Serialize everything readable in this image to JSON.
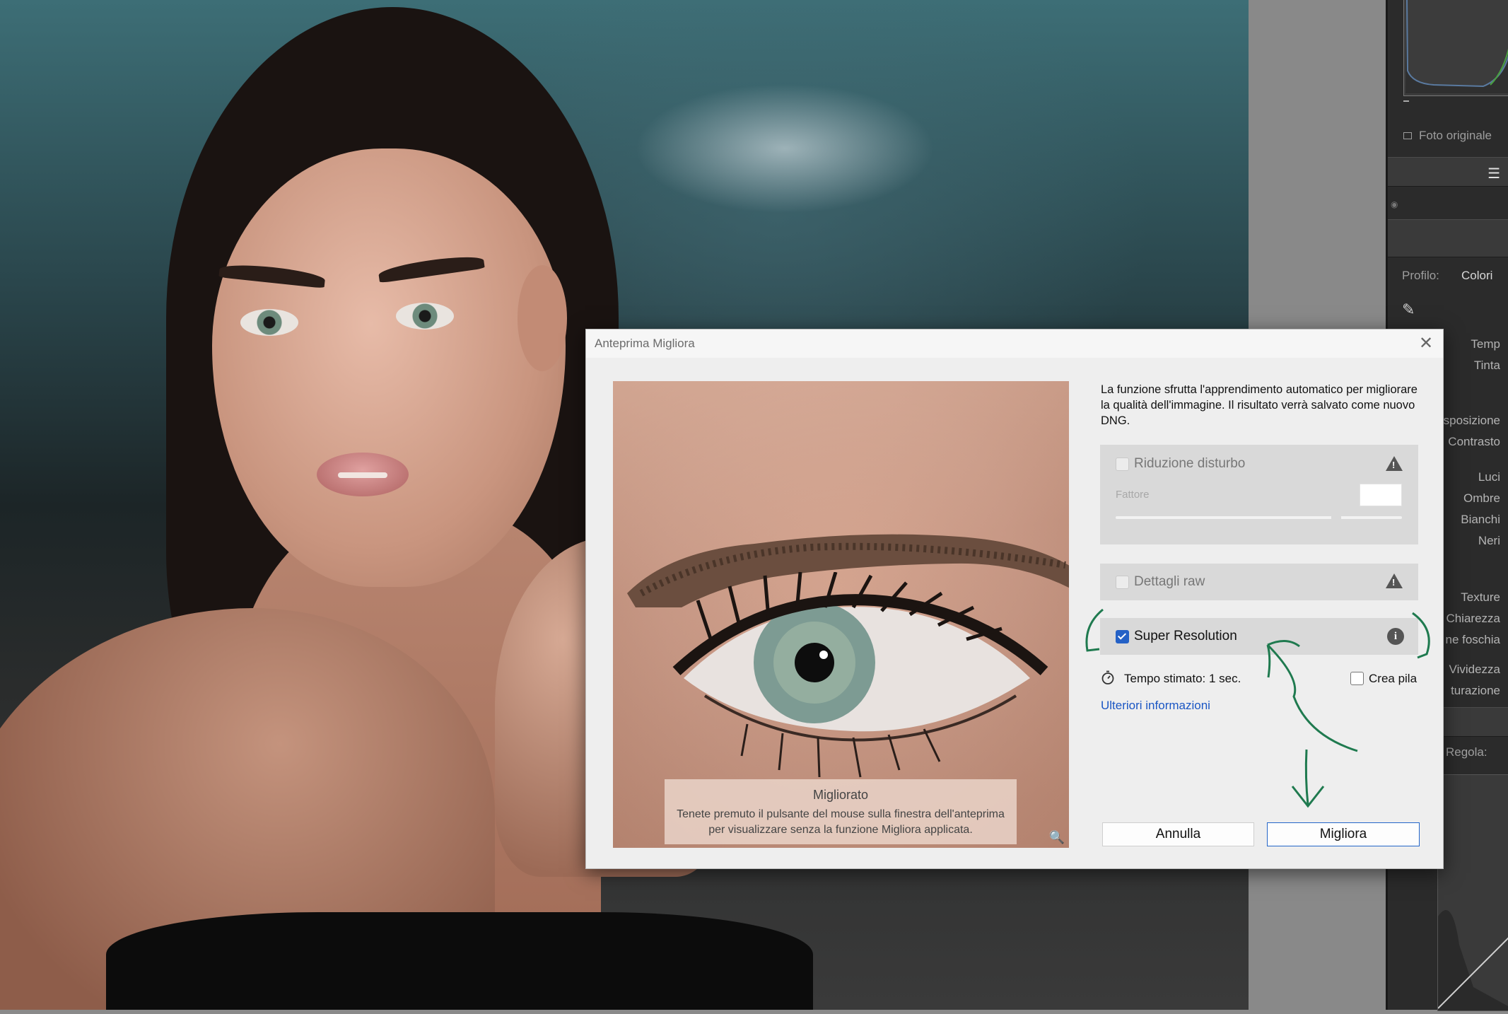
{
  "right_panel": {
    "original_photo_label": "Foto originale",
    "profile_label": "Profilo:",
    "profile_value": "Colori",
    "basic_labels": [
      "Temp",
      "Tinta",
      "sposizione",
      "Contrasto",
      "Luci",
      "Ombre",
      "Bianchi",
      "Neri",
      "Texture",
      "Chiarezza",
      "ne foschia",
      "Vividezza",
      "turazione"
    ],
    "curve_label": "Regola:"
  },
  "dialog": {
    "title": "Anteprima Migliora",
    "close_icon": "close-icon",
    "intro_text": "La funzione sfrutta l'apprendimento automatico per migliorare la qualità dell'immagine. Il risultato verrà salvato come nuovo DNG.",
    "preview": {
      "caption_title": "Migliorato",
      "caption_text": "Tenete premuto il pulsante del mouse sulla finestra dell'anteprima per visualizzare senza la funzione Migliora applicata.",
      "zoom_icon": "zoom-icon"
    },
    "options": {
      "noise_reduction": {
        "label": "Riduzione disturbo",
        "checked": false,
        "enabled": false,
        "icon": "warning-icon",
        "factor_label": "Fattore"
      },
      "raw_details": {
        "label": "Dettagli raw",
        "checked": false,
        "enabled": false,
        "icon": "warning-icon"
      },
      "super_resolution": {
        "label": "Super Resolution",
        "checked": true,
        "enabled": true,
        "icon": "info-icon"
      }
    },
    "estimated_time": "Tempo stimato: 1 sec.",
    "create_stack_label": "Crea pila",
    "create_stack_checked": false,
    "more_info_link": "Ulteriori informazioni",
    "cancel_label": "Annulla",
    "enhance_label": "Migliora"
  },
  "colors": {
    "accent": "#2461c6",
    "link": "#1a56c4",
    "annotation": "#1f7a4f"
  }
}
